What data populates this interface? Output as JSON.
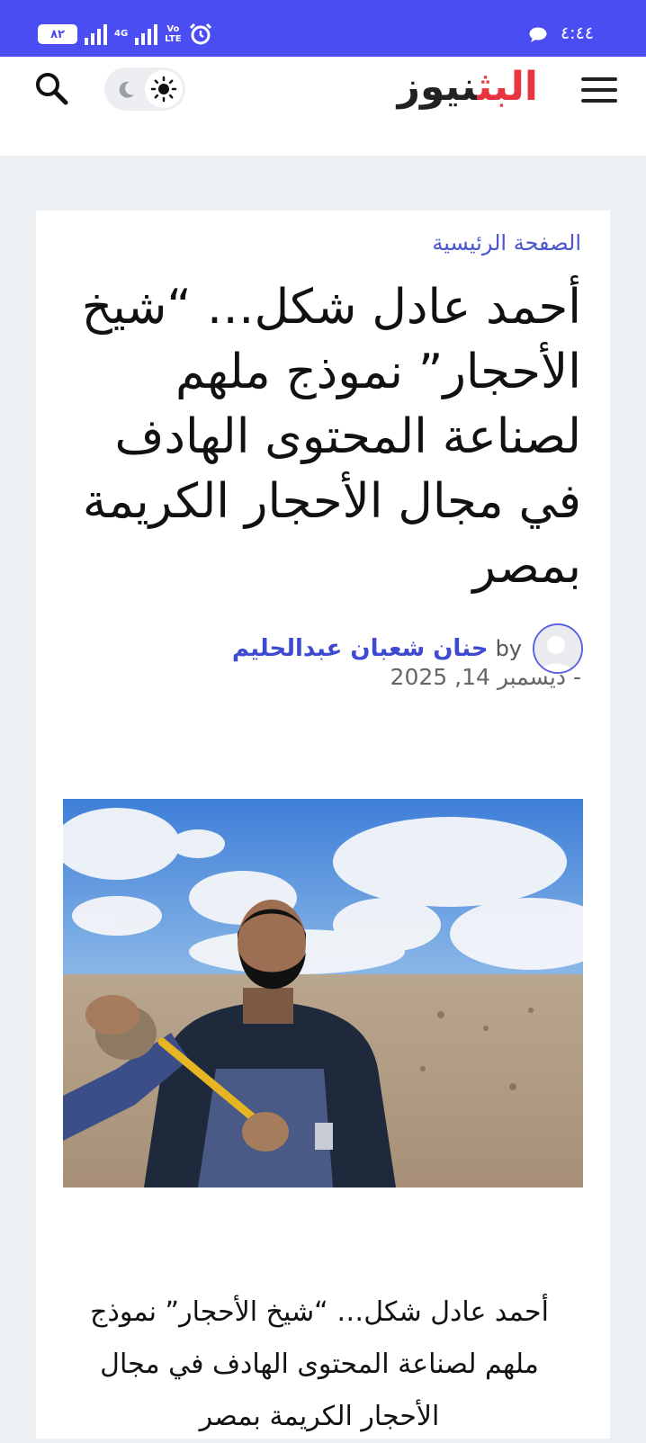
{
  "status_bar": {
    "time": "٤:٤٤",
    "battery": "٨٢",
    "network": "4G",
    "volte": "Vo\nLTE"
  },
  "header": {
    "logo_red": "البث",
    "logo_dark": "نيوز"
  },
  "article": {
    "breadcrumb": "الصفحة الرئيسية",
    "title": "أحمد عادل شكل… “شيخ الأحجار” نموذج ملهم لصناعة المحتوى الهادف في مجال الأحجار الكريمة بمصر",
    "by_label": "by",
    "author": "حنان شعبان عبدالحليم",
    "date": "- ديسمبر 14, 2025",
    "excerpt": "أحمد عادل شكل… “شيخ الأحجار” نموذج ملهم لصناعة المحتوى الهادف في مجال الأحجار الكريمة بمصر"
  },
  "colors": {
    "status_bar": "#4a4df2",
    "logo_accent": "#e8353f",
    "link": "#3e4ad0",
    "page_bg": "#edf1f4"
  },
  "icons": [
    "menu-icon",
    "sun-icon",
    "moon-icon",
    "search-icon",
    "alarm-icon",
    "chat-icon"
  ]
}
